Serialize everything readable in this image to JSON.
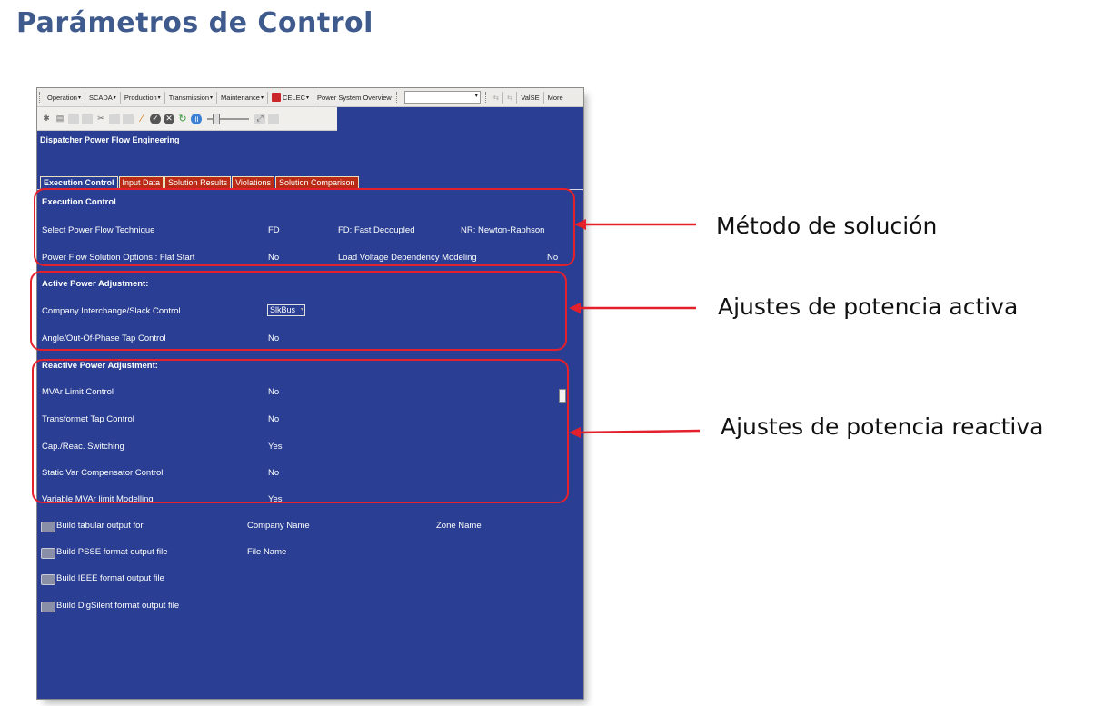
{
  "slide": {
    "title": "Parámetros de Control"
  },
  "menubar": {
    "items": [
      "Operation",
      "SCADA",
      "Production",
      "Transmission",
      "Maintenance"
    ],
    "celec": "CELEC",
    "power_system_overview": "Power System Overview",
    "valse": "ValSE",
    "more": "More"
  },
  "window": {
    "title": "Dispatcher  Power Flow Engineering"
  },
  "tabs": [
    "Execution Control",
    "Input Data",
    "Solution Results",
    "Violations",
    "Solution Comparison"
  ],
  "execution": {
    "header": "Execution Control",
    "technique_label": "Select Power Flow Technique",
    "technique_value": "FD",
    "fd_note": "FD: Fast Decoupled",
    "nr_note": "NR: Newton-Raphson",
    "flat_start_label": "Power Flow Solution Options : Flat Start",
    "flat_start_value": "No",
    "lvd_label": "Load Voltage Dependency Modeling",
    "lvd_value": "No"
  },
  "active": {
    "header": "Active Power Adjustment:",
    "company_label": "Company Interchange/Slack Control",
    "company_value": "SlkBus",
    "angle_label": "Angle/Out-Of-Phase Tap Control",
    "angle_value": "No"
  },
  "reactive": {
    "header": "Reactive Power Adjustment:",
    "mvar_label": "MVAr Limit Control",
    "mvar_value": "No",
    "tap_label": "Transformet Tap Control",
    "tap_value": "No",
    "cap_label": "Cap./Reac. Switching",
    "cap_value": "Yes",
    "svc_label": "Static Var Compensator Control",
    "svc_value": "No",
    "var_label": "Variable MVAr limit Modelling",
    "var_value": "Yes"
  },
  "outputs": {
    "tabular": "Build tabular output for",
    "company_name": "Company Name",
    "zone_name": "Zone Name",
    "psse": "Build PSSE format output file",
    "file_name": "File Name",
    "ieee": "Build IEEE format output file",
    "digsilent": "Build DigSilent format output file"
  },
  "callouts": {
    "method": "Método de solución",
    "active": "Ajustes de potencia activa",
    "reactive": "Ajustes de potencia reactiva"
  },
  "colors": {
    "panel_bg": "#2a3f93",
    "tab_bg": "#ba2b16",
    "highlight": "#e4202c",
    "title": "#3f5a8c"
  }
}
